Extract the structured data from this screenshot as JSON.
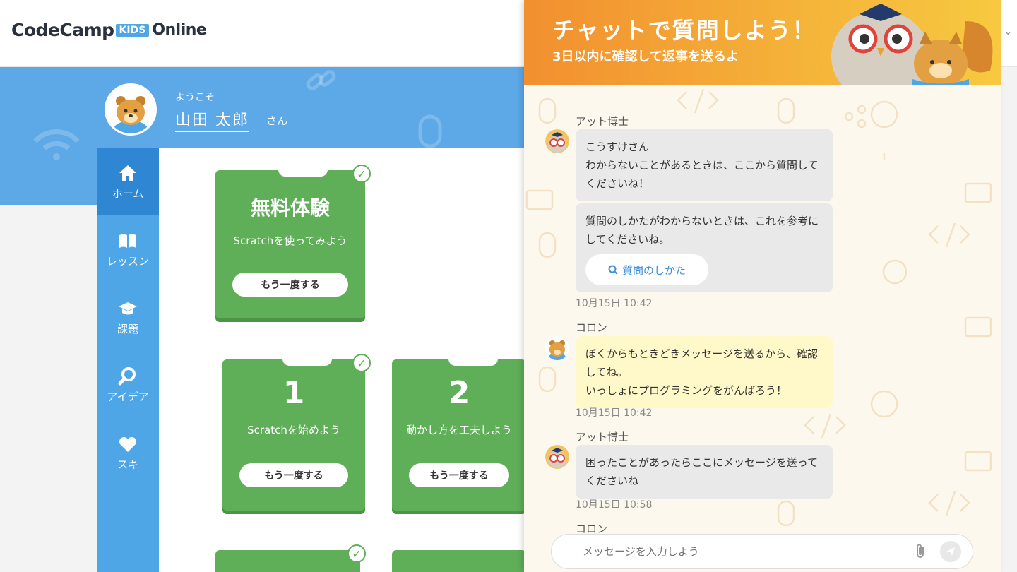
{
  "header": {
    "logo_main": "CodeCamp",
    "logo_kids": "KIDS",
    "logo_online": "Online"
  },
  "profile": {
    "welcome": "ようこそ",
    "name": "山田 太郎",
    "suffix": "さん"
  },
  "sidebar": {
    "items": [
      {
        "label": "ホーム",
        "icon": "home-icon",
        "active": true
      },
      {
        "label": "レッスン",
        "icon": "book-icon",
        "active": false
      },
      {
        "label": "課題",
        "icon": "graduation-cap-icon",
        "active": false
      },
      {
        "label": "アイデア",
        "icon": "search-icon",
        "active": false
      },
      {
        "label": "スキ",
        "icon": "heart-icon",
        "active": false
      }
    ]
  },
  "lessons": [
    {
      "title": "無料体験",
      "subtitle": "Scratchを使ってみよう",
      "button": "もう一度する",
      "done": true
    },
    {
      "title": "1",
      "subtitle": "Scratchを始めよう",
      "button": "もう一度する",
      "done": true
    },
    {
      "title": "2",
      "subtitle": "動かし方を工夫しよう",
      "button": "もう一度する",
      "done": false
    }
  ],
  "chat": {
    "title": "チャットで質問しよう！",
    "subtitle": "3日以内に確認して返事を送るよ",
    "messages": [
      {
        "sender": "アット博士",
        "bubbles": [
          "こうすけさん\nわからないことがあるときは、ここから質問してくださいね！",
          "質問のしかたがわからないときは、これを参考にしてくださいね。"
        ],
        "link_button": "質問のしかた",
        "time": "10月15日 10:42"
      },
      {
        "sender": "コロン",
        "bubbles": [
          "ぼくからもときどきメッセージを送るから、確認してね。\nいっしょにプログラミングをがんばろう！"
        ],
        "time": "10月15日 10:42"
      },
      {
        "sender": "アット博士",
        "bubbles": [
          "困ったことがあったらここにメッセージを送ってくださいね"
        ],
        "time": "10月15日 10:58"
      },
      {
        "sender": "コロン"
      }
    ],
    "input_placeholder": "メッセージを入力しよう"
  },
  "colors": {
    "brand_blue": "#4ea6e6",
    "card_green": "#5fae58",
    "chat_orange": "#f28f2f"
  }
}
